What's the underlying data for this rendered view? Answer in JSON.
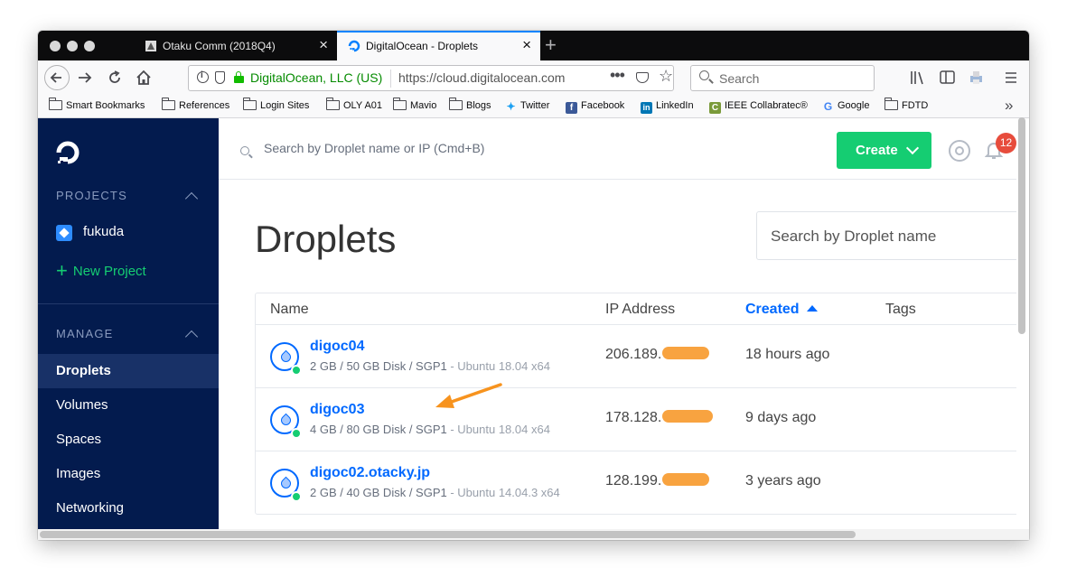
{
  "browser": {
    "tabs": [
      {
        "title": "Otaku Comm (2018Q4)",
        "close": "×"
      },
      {
        "title": "DigitalOcean - Droplets",
        "close": "×"
      }
    ],
    "new_tab": "+",
    "url_org": "DigitalOcean, LLC (US)",
    "url": "https://cloud.digitalocean.com",
    "url_more": "•••",
    "search_placeholder": "Search",
    "overflow": "»",
    "bookmarks": [
      {
        "label": "Smart Bookmarks",
        "icon": "folder-icon"
      },
      {
        "label": "References",
        "icon": "folder-icon"
      },
      {
        "label": "Login Sites",
        "icon": "folder-icon"
      },
      {
        "label": "OLY A01",
        "icon": "folder-icon"
      },
      {
        "label": "Mavio",
        "icon": "folder-icon"
      },
      {
        "label": "Blogs",
        "icon": "folder-icon"
      },
      {
        "label": "Twitter",
        "icon": "twitter-icon"
      },
      {
        "label": "Facebook",
        "icon": "facebook-icon"
      },
      {
        "label": "LinkedIn",
        "icon": "linkedin-icon"
      },
      {
        "label": "IEEE Collabratec®",
        "icon": "ieee-icon"
      },
      {
        "label": "Google",
        "icon": "google-icon"
      },
      {
        "label": "FDTD",
        "icon": "folder-icon"
      }
    ]
  },
  "sidebar": {
    "projects_heading": "PROJECTS",
    "project": "fukuda",
    "new_project": "New Project",
    "new_project_plus": "+",
    "manage_heading": "MANAGE",
    "nav": [
      "Droplets",
      "Volumes",
      "Spaces",
      "Images",
      "Networking"
    ]
  },
  "topbar": {
    "search_placeholder": "Search by Droplet name or IP (Cmd+B)",
    "create_label": "Create",
    "notification_count": "12"
  },
  "main": {
    "title": "Droplets",
    "name_search_placeholder": "Search by Droplet name",
    "columns": {
      "name": "Name",
      "ip": "IP Address",
      "created": "Created",
      "tags": "Tags"
    },
    "droplets": [
      {
        "name": "digoc04",
        "spec": "2 GB / 50 GB Disk / SGP1",
        "os": " - Ubuntu 18.04 x64",
        "ip": "206.189.",
        "created": "18 hours ago"
      },
      {
        "name": "digoc03",
        "spec": "4 GB / 80 GB Disk / SGP1",
        "os": " - Ubuntu 18.04 x64",
        "ip": "178.128.",
        "created": "9 days ago"
      },
      {
        "name": "digoc02.otacky.jp",
        "spec": "2 GB / 40 GB Disk / SGP1",
        "os": " - Ubuntu 14.04.3 x64",
        "ip": "128.199.",
        "created": "3 years ago"
      }
    ]
  },
  "colors": {
    "sidebar_bg": "#031b4e",
    "accent_green": "#15cd72",
    "link_blue": "#0069ff",
    "annotation_orange": "#f7931e",
    "badge_red": "#e74c3c"
  }
}
